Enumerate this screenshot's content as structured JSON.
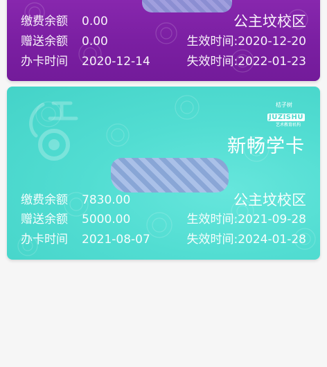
{
  "cards": [
    {
      "campus": "公主坟校区",
      "paid_balance_label": "缴费余额",
      "paid_balance": "0.00",
      "bonus_balance_label": "赠送余额",
      "bonus_balance": "0.00",
      "issue_date_label": "办卡时间",
      "issue_date": "2020-12-14",
      "effective_time": "生效时间:2020-12-20",
      "expire_time": "失效时间:2022-01-23",
      "color": "#7b1fa2"
    },
    {
      "title": "新畅学卡",
      "brand_top": "桔子树",
      "brand_name": "JUZISHU",
      "brand_sub": "艺术教育机构",
      "campus": "公主坟校区",
      "paid_balance_label": "缴费余额",
      "paid_balance": "7830.00",
      "bonus_balance_label": "赠送余额",
      "bonus_balance": "5000.00",
      "issue_date_label": "办卡时间",
      "issue_date": "2021-08-07",
      "effective_time": "生效时间:2021-09-28",
      "expire_time": "失效时间:2024-01-28",
      "color": "#4fd8cd"
    }
  ]
}
